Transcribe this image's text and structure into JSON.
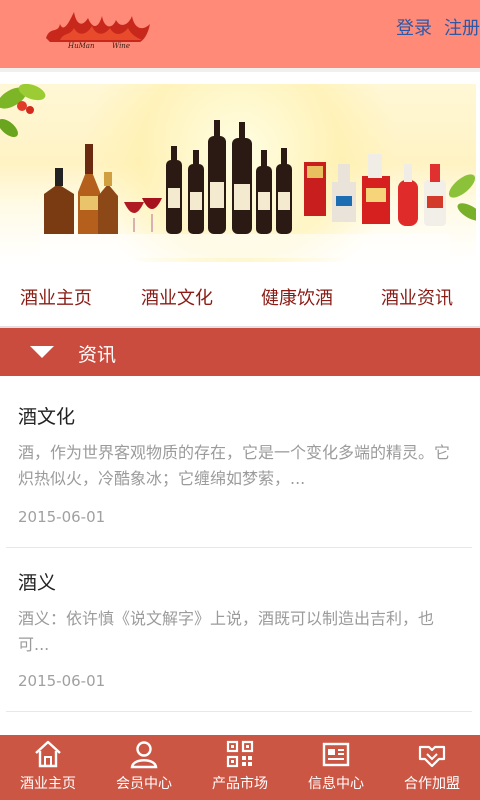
{
  "header": {
    "login": "登录",
    "register": "注册"
  },
  "nav": {
    "items": [
      "酒业主页",
      "酒业文化",
      "健康饮酒",
      "酒业资讯"
    ]
  },
  "section": {
    "title": "资讯"
  },
  "news": [
    {
      "title": "酒文化",
      "summary": "酒，作为世界客观物质的存在，它是一个变化多端的精灵。它炽热似火，冷酷象冰；它缠绵如梦萦，...",
      "date": "2015-06-01"
    },
    {
      "title": "酒义",
      "summary": "酒义：依许慎《说文解字》上说，酒既可以制造出吉利，也可...",
      "date": "2015-06-01"
    }
  ],
  "tabbar": {
    "items": [
      {
        "label": "酒业主页",
        "icon": "home-icon"
      },
      {
        "label": "会员中心",
        "icon": "user-icon"
      },
      {
        "label": "产品市场",
        "icon": "qrcode-icon"
      },
      {
        "label": "信息中心",
        "icon": "news-icon"
      },
      {
        "label": "合作加盟",
        "icon": "handshake-icon"
      }
    ]
  },
  "colors": {
    "header": "#ff8a78",
    "accent": "#c94c3f",
    "tabbar": "#cb5644",
    "nav_text": "#8a1c15",
    "link": "#2d58a8"
  }
}
